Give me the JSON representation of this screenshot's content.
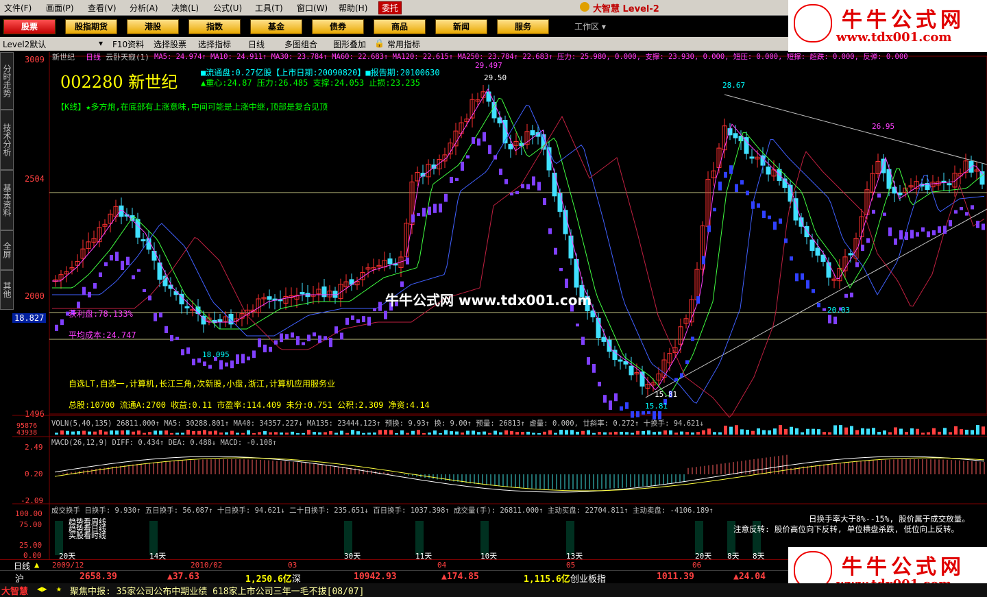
{
  "menu": [
    "文件(F)",
    "画面(P)",
    "查看(V)",
    "分析(A)",
    "决策(L)",
    "公式(U)",
    "工具(T)",
    "窗口(W)",
    "帮助(H)"
  ],
  "entrust_label": "委托",
  "app_title": "大智慧 Level-2",
  "nav_buttons": [
    "股票",
    "股指期货",
    "港股",
    "指数",
    "基金",
    "债券",
    "商品",
    "新闻",
    "服务"
  ],
  "workspace_label": "工作区",
  "toolbar": [
    "Level2默认",
    "F10资料",
    "选择股票",
    "选择指标",
    "日线",
    "多图组合",
    "图形叠加",
    "常用指标"
  ],
  "watermark": {
    "title": "牛牛公式网",
    "url": "www.tdx001.com",
    "center": "牛牛公式网 www.tdx001.com"
  },
  "side_tabs": [
    "分时走势",
    "技术分析",
    "基本资料",
    "全屏",
    "其他"
  ],
  "stock": {
    "name_line": "新世纪",
    "period": "日线",
    "indicator": "云卧天窥(1)",
    "ma_line": "MA5: 24.974↑ MA10: 24.911↑ MA30: 23.784↑ MA60: 22.683↑ MA120: 22.615↑ MA250: 23.784↑ 22.683↑ 压力: 25.980, 0.000, 支撑: 23.930, 0.000, 短压: 0.000, 短撑: 超跌: 0.000, 反弹: 0.000",
    "code_name": "002280 新世纪",
    "info1": "■流通盘:0.27亿股【上市日期:20090820】■报告期:20100630",
    "info2": "▲重心:24.87 压力:26.485 支撑:24.053 止损:23.235",
    "kline_comment": "【K线】★多方炮,在底部有上涨意味,中间可能是上涨中继,顶部是复合见顶",
    "profit": "获利盘:78.133%",
    "avg_cost": "平均成本:24.747",
    "tags": "自选LT,自选一,计算机,长江三角,次新股,小盘,浙江,计算机应用服务业",
    "fundamentals": "总股:10700 流通A:2700 收益:0.11 市盈率:114.409 未分:0.751 公积:2.309 净资:4.14",
    "price_labels": [
      "3009",
      "2504",
      "2000",
      "1496"
    ],
    "current_price": "18.827",
    "annotations": [
      "29.50",
      "29.497",
      "28.67",
      "26.95",
      "20.03",
      "18.095",
      "15.81",
      "15.81"
    ]
  },
  "volume_line": "VOLN(5,40,135) 26811.000↑ MA5: 30288.801↑ MA40: 34357.227↓ MA135: 23444.123↑ 预换: 9.93↑ 换: 9.00↑ 预量: 26813↑ 虚量: 0.000, 廿斜率: 0.272↑ 十换手: 94.621↓",
  "volume_axis": [
    "95876",
    "43938"
  ],
  "macd_line": "MACD(26,12,9) DIFF: 0.434↑ DEA: 0.488↓ MACD: -0.108↑",
  "macd_axis": [
    "2.49",
    "0.20",
    "-2.09"
  ],
  "turnover_line": "成交换手 日换手: 9.930↑ 五日换手: 56.087↑ 十日换手: 94.621↓ 二十日换手: 235.651↓ 百日换手: 1037.398↑ 成交量(手): 26811.000↑ 主动买盘: 22704.811↑ 主动卖盘: -4106.189↑",
  "turnover_axis": [
    "100.00",
    "75.00",
    "25.00",
    "0.00"
  ],
  "turnover_notes": [
    "日换手率大于8%--15%, 股价属于成交放量。",
    "注意反转: 股价高位向下反转, 单位横盘杀跌, 低位向上反转。"
  ],
  "legend_small": [
    "趋势看周线",
    "趋势看日线",
    "买股看时线"
  ],
  "days_labels": [
    "20天",
    "14天",
    "30天",
    "11天",
    "10天",
    "13天",
    "20天",
    "8天",
    "8天"
  ],
  "date_axis": [
    "日线",
    "2009/12",
    "2010/02",
    "03",
    "04",
    "05",
    "06"
  ],
  "index_bar": {
    "sh_label": "沪",
    "sh_value": "2658.39",
    "sh_change": "▲37.63",
    "sh_amount": "1,250.6亿",
    "sz_label": "深",
    "sz_value": "10942.93",
    "sz_change": "▲174.85",
    "sz_amount": "1,115.6亿",
    "cyb_label": "创业板指",
    "cyb_value": "1011.39",
    "cyb_change": "▲24.04"
  },
  "ticker": {
    "brand": "大智慧",
    "text": "聚焦中报: 35家公司公布中期业绩 618家上市公司三年一毛不拔[08/07]"
  }
}
